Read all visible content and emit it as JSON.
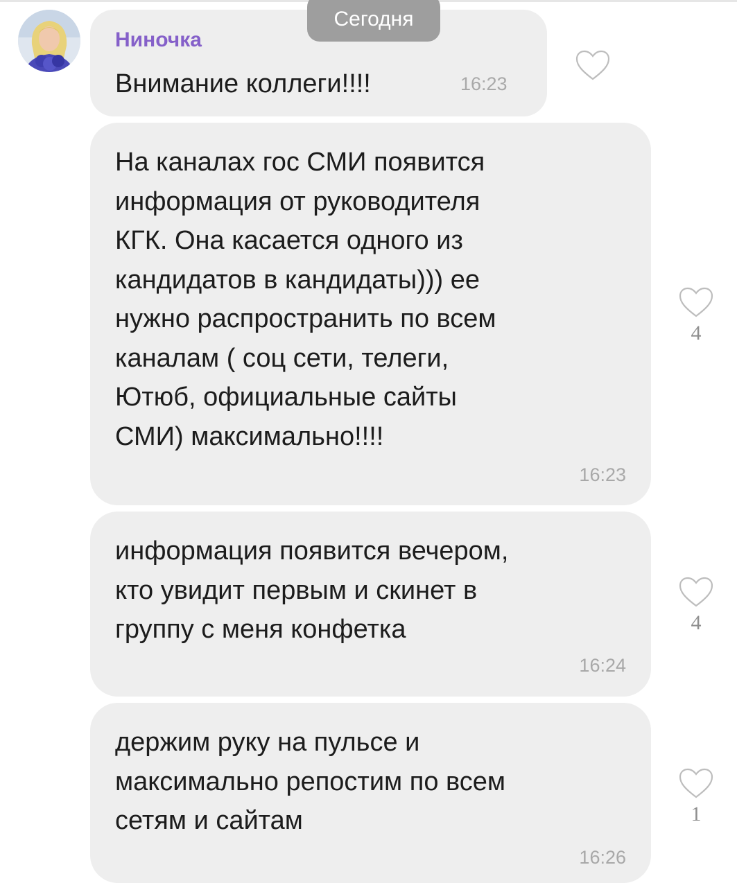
{
  "date_divider": "Сегодня",
  "messages": [
    {
      "sender": "Ниночка",
      "text": "Внимание коллеги!!!!",
      "time": "16:23",
      "likes": ""
    },
    {
      "text": "На каналах гос СМИ появится\nинформация от руководителя\nКГК. Она касается одного из\nкандидатов в кандидаты))) ее\nнужно распространить по всем\nканалам ( соц сети, телеги,\nЮтюб, официальные сайты\nСМИ) максимально!!!!",
      "time": "16:23",
      "likes": "4"
    },
    {
      "text": "информация появится вечером,\nкто увидит первым и скинет в\nгруппу с меня конфетка",
      "time": "16:24",
      "likes": "4"
    },
    {
      "text": "держим руку на пульсе и\nмаксимально репостим по всем\nсетям и сайтам",
      "time": "16:26",
      "likes": "1"
    }
  ],
  "icons": {
    "like": "heart-outline-icon",
    "avatar": "user-avatar"
  },
  "colors": {
    "sender_name": "#8560c9",
    "bubble": "#eeeeee",
    "date_pill": "#9e9e9e",
    "timestamp": "#a8a8a8"
  }
}
